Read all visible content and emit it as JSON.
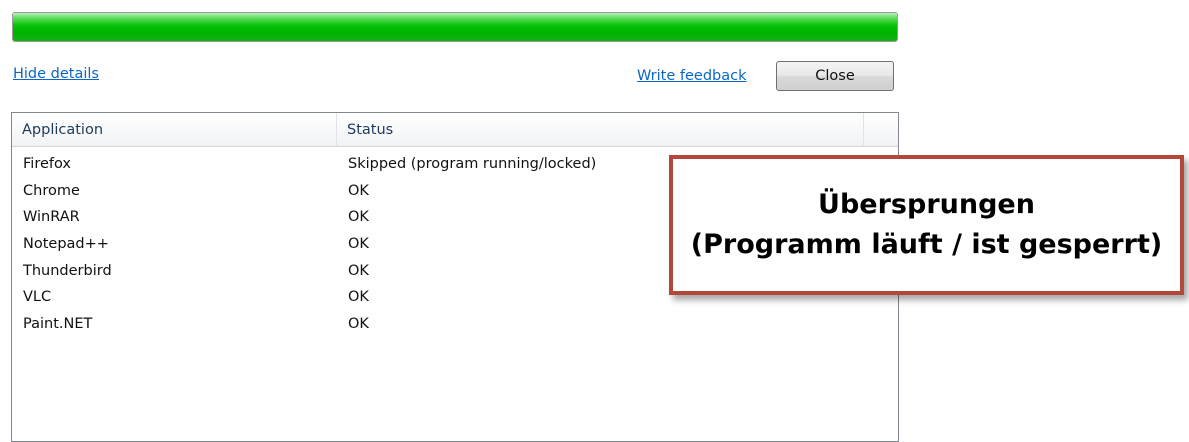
{
  "progress": {
    "value_percent": 100,
    "color": "#00b300"
  },
  "links": {
    "hide_details": "Hide details",
    "write_feedback": "Write feedback"
  },
  "buttons": {
    "close": "Close"
  },
  "table": {
    "columns": [
      "Application",
      "Status"
    ],
    "rows": [
      {
        "application": "Firefox",
        "status": "Skipped (program running/locked)"
      },
      {
        "application": "Chrome",
        "status": "OK"
      },
      {
        "application": "WinRAR",
        "status": "OK"
      },
      {
        "application": "Notepad++",
        "status": "OK"
      },
      {
        "application": "Thunderbird",
        "status": "OK"
      },
      {
        "application": "VLC",
        "status": "OK"
      },
      {
        "application": "Paint.NET",
        "status": "OK"
      }
    ]
  },
  "annotation": {
    "highlight_color": "#f4f75a",
    "border_color": "#b5473a",
    "line1": "Übersprungen",
    "line2": "(Programm läuft / ist gesperrt)"
  }
}
